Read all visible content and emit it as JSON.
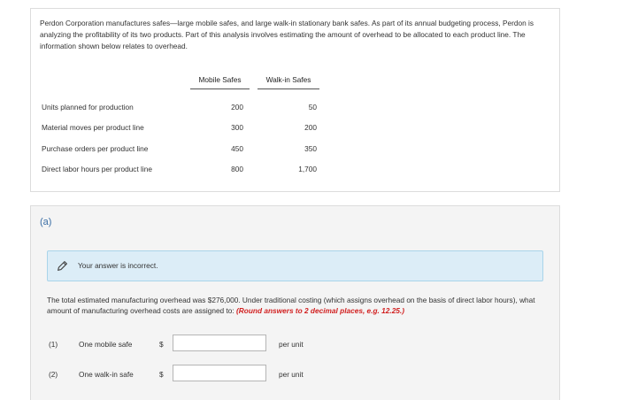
{
  "problem": {
    "intro": "Perdon Corporation manufactures safes—large mobile safes, and large walk-in stationary bank safes. As part of its annual budgeting process, Perdon is analyzing the profitability of its two products. Part of this analysis involves estimating the amount of overhead to be allocated to each product line. The information shown below relates to overhead.",
    "table": {
      "columns": [
        "Mobile Safes",
        "Walk-in Safes"
      ],
      "rows": [
        {
          "label": "Units planned for production",
          "mobile": "200",
          "walkin": "50"
        },
        {
          "label": "Material moves per product line",
          "mobile": "300",
          "walkin": "200"
        },
        {
          "label": "Purchase orders per product line",
          "mobile": "450",
          "walkin": "350"
        },
        {
          "label": "Direct labor hours per product line",
          "mobile": "800",
          "walkin": "1,700"
        }
      ]
    }
  },
  "part_a": {
    "label": "(a)",
    "alert": {
      "icon": "pencil-icon",
      "text": "Your answer is incorrect."
    },
    "question": "The total estimated manufacturing overhead was $276,000. Under traditional costing (which assigns overhead on the basis of direct labor hours), what amount of manufacturing overhead costs are assigned to:",
    "hint": "(Round answers to 2 decimal places, e.g. 12.25.)",
    "answers": [
      {
        "num": "(1)",
        "label": "One mobile safe",
        "currency": "$",
        "value": "",
        "unit": "per unit"
      },
      {
        "num": "(2)",
        "label": "One walk-in safe",
        "currency": "$",
        "value": "",
        "unit": "per unit"
      }
    ]
  }
}
